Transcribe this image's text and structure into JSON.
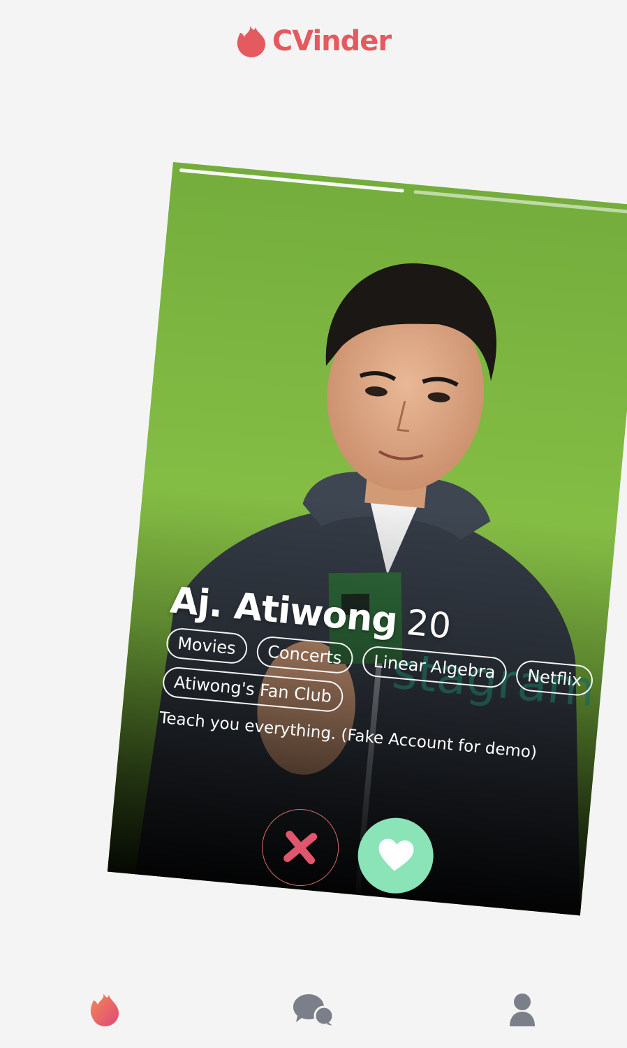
{
  "app": {
    "name": "CVinder",
    "brand_color": "#e45a5f"
  },
  "card": {
    "photo_count": 2,
    "active_photo": 1,
    "name": "Aj. Atiwong",
    "age": "20",
    "tags": [
      "Movies",
      "Concerts",
      "Linear Algebra",
      "Netflix",
      "Atiwong's Fan Club"
    ],
    "bio": "Teach you everything. (Fake Account for demo)",
    "photo_background": "#7eb642"
  },
  "actions": {
    "nope_icon": "close-icon",
    "nope_color": "#e0566c",
    "like_icon": "heart-icon",
    "like_color": "#8be3b8"
  },
  "nav": {
    "items": [
      {
        "icon": "flame-icon",
        "active": true
      },
      {
        "icon": "chat-icon",
        "active": false
      },
      {
        "icon": "profile-icon",
        "active": false
      }
    ],
    "inactive_color": "#7a7f8a"
  }
}
